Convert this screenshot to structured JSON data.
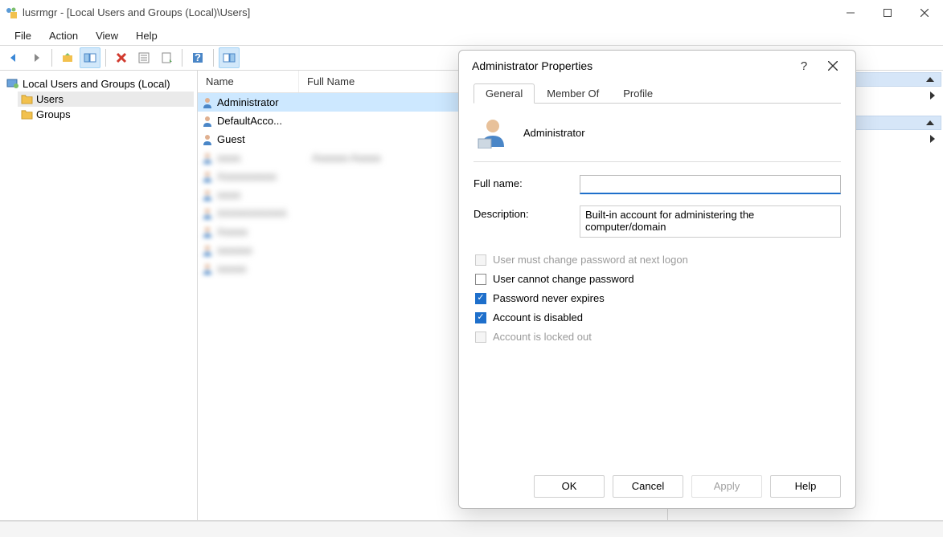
{
  "window": {
    "title": "lusrmgr - [Local Users and Groups (Local)\\Users]"
  },
  "menu": {
    "file": "File",
    "action": "Action",
    "view": "View",
    "help": "Help"
  },
  "tree": {
    "root": "Local Users and Groups (Local)",
    "users": "Users",
    "groups": "Groups"
  },
  "columns": {
    "name": "Name",
    "fullname": "Full Name"
  },
  "users": [
    {
      "name": "Administrator",
      "fullname": "",
      "selected": true
    },
    {
      "name": "DefaultAcco...",
      "fullname": ""
    },
    {
      "name": "Guest",
      "fullname": ""
    }
  ],
  "dialog": {
    "title": "Administrator Properties",
    "tabs": {
      "general": "General",
      "memberof": "Member Of",
      "profile": "Profile"
    },
    "username": "Administrator",
    "labels": {
      "fullname": "Full name:",
      "description": "Description:"
    },
    "fullname_value": "",
    "description_value": "Built-in account for administering the computer/domain",
    "checks": {
      "must_change": "User must change password at next logon",
      "cannot_change": "User cannot change password",
      "never_expires": "Password never expires",
      "disabled": "Account is disabled",
      "locked": "Account is locked out"
    },
    "buttons": {
      "ok": "OK",
      "cancel": "Cancel",
      "apply": "Apply",
      "help": "Help"
    }
  }
}
